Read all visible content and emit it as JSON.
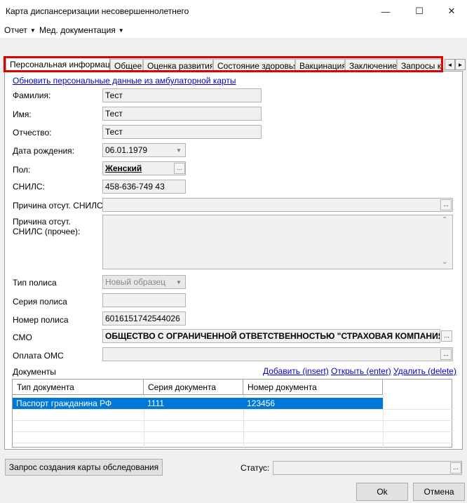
{
  "window": {
    "title": "Карта диспансеризации несовершеннолетнего",
    "minimize_glyph": "—",
    "maximize_glyph": "☐",
    "close_glyph": "✕"
  },
  "menu": [
    {
      "label": "Отчет"
    },
    {
      "label": "Мед. документация"
    }
  ],
  "tabs": [
    {
      "label": "Персональная информация",
      "active": true
    },
    {
      "label": "Общее"
    },
    {
      "label": "Оценка развития"
    },
    {
      "label": "Состояние здоровья"
    },
    {
      "label": "Вакцинация"
    },
    {
      "label": "Заключение"
    },
    {
      "label": "Запросы к"
    }
  ],
  "tab_scroll": {
    "left": "◄",
    "right": "►"
  },
  "update_link": "Обновить персональные данные из амбулаторной карты",
  "fields": {
    "surname": {
      "label": "Фамилия:",
      "value": "Тест"
    },
    "name": {
      "label": "Имя:",
      "value": "Тест"
    },
    "patronymic": {
      "label": "Отчество:",
      "value": "Тест"
    },
    "birth_date": {
      "label": "Дата рождения:",
      "value": "06.01.1979"
    },
    "sex": {
      "label": "Пол:",
      "value": "Женский"
    },
    "snils": {
      "label": "СНИЛС:",
      "value": "458-636-749 43"
    },
    "snils_absent_reason": {
      "label": "Причина отсут. СНИЛС:",
      "value": ""
    },
    "snils_absent_other": {
      "label": "Причина отсут. СНИЛС (прочее):",
      "value": ""
    },
    "policy_type": {
      "label": "Тип полиса",
      "value": "Новый образец"
    },
    "policy_series": {
      "label": "Серия полиса",
      "value": ""
    },
    "policy_number": {
      "label": "Номер полиса",
      "value": "6016151742544026"
    },
    "smo": {
      "label": "СМО",
      "value": "ОБЩЕСТВО С ОГРАНИЧЕННОЙ ОТВЕТСТВЕННОСТЬЮ \"СТРАХОВАЯ КОМПАНИЯ"
    },
    "oms_payment": {
      "label": "Оплата ОМС",
      "value": ""
    }
  },
  "documents": {
    "label": "Документы",
    "actions": {
      "add": "Добавить (insert)",
      "open": "Открыть (enter)",
      "delete": "Удалить (delete)"
    },
    "columns": [
      "Тип документа",
      "Серия документа",
      "Номер документа"
    ],
    "rows": [
      [
        "Паспорт гражданина РФ",
        "1111",
        "123456"
      ]
    ]
  },
  "footer": {
    "request_button": "Запрос создания карты обследования",
    "status_label": "Статус:",
    "status_value": "",
    "ok": "Ok",
    "cancel": "Отмена"
  },
  "glyphs": {
    "ellipsis": "...",
    "dropdown": "▼",
    "scroll_up": "⌃",
    "scroll_down": "⌄",
    "menu_arrow": "▼"
  },
  "colors": {
    "selection": "#0078d7",
    "highlight_border": "#e00000",
    "link": "#0000cc"
  }
}
